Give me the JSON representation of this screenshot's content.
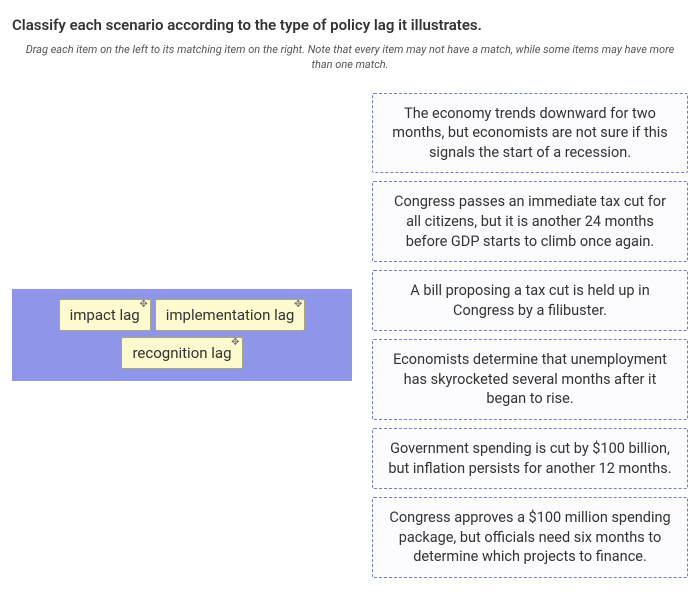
{
  "question": {
    "title": "Classify each scenario according to the type of policy lag it illustrates.",
    "instructions": "Drag each item on the left to its matching item on the right. Note that every item may not have a match, while some items may have more than one match."
  },
  "drag_items": [
    {
      "label": "impact lag"
    },
    {
      "label": "implementation lag"
    },
    {
      "label": "recognition lag"
    }
  ],
  "drop_targets": [
    {
      "text": "The economy trends downward for two months, but economists are not sure if this signals the start of a recession."
    },
    {
      "text": "Congress passes an immediate tax cut for all citizens, but it is another 24 months before GDP starts to climb once again."
    },
    {
      "text": "A bill proposing a tax cut is held up in Congress by a filibuster."
    },
    {
      "text": "Economists determine that unemployment has skyrocketed several months after it began to rise."
    },
    {
      "text": "Government spending is cut by $100 billion, but inflation persists for another 12 months."
    },
    {
      "text": "Congress approves a $100 million spending package, but officials need six months to determine which projects to finance."
    }
  ]
}
